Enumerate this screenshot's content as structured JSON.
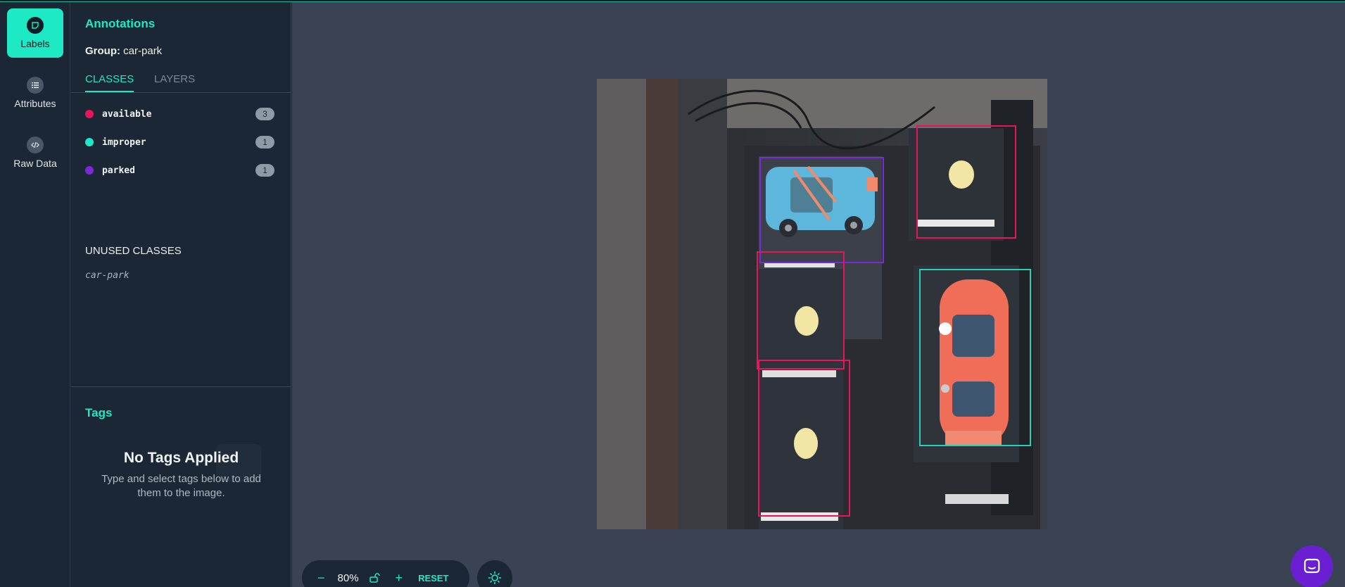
{
  "rail": {
    "items": [
      {
        "label": "Labels",
        "icon": "label-icon",
        "active": true
      },
      {
        "label": "Attributes",
        "icon": "list-icon",
        "active": false
      },
      {
        "label": "Raw Data",
        "icon": "code-icon",
        "active": false
      }
    ]
  },
  "annotations": {
    "title": "Annotations",
    "group_label": "Group:",
    "group_value": "car-park",
    "tabs": [
      "CLASSES",
      "LAYERS"
    ],
    "classes": [
      {
        "name": "available",
        "count": "3",
        "color": "#e8155c"
      },
      {
        "name": "improper",
        "count": "1",
        "color": "#1de9c4"
      },
      {
        "name": "parked",
        "count": "1",
        "color": "#7a2ad8"
      }
    ],
    "unused_title": "UNUSED CLASSES",
    "unused_classes": [
      "car-park"
    ]
  },
  "tags": {
    "title": "Tags",
    "empty_title": "No Tags Applied",
    "empty_text": "Type and select tags below to add them to the image."
  },
  "toolbar": {
    "zoom_out": "−",
    "zoom_value": "80%",
    "zoom_in": "+",
    "reset_label": "RESET"
  },
  "colors": {
    "accent": "#1de9c4",
    "available": "#e8155c",
    "improper": "#25d0b7",
    "parked": "#7a2ad8",
    "chat": "#6a1fd3"
  }
}
